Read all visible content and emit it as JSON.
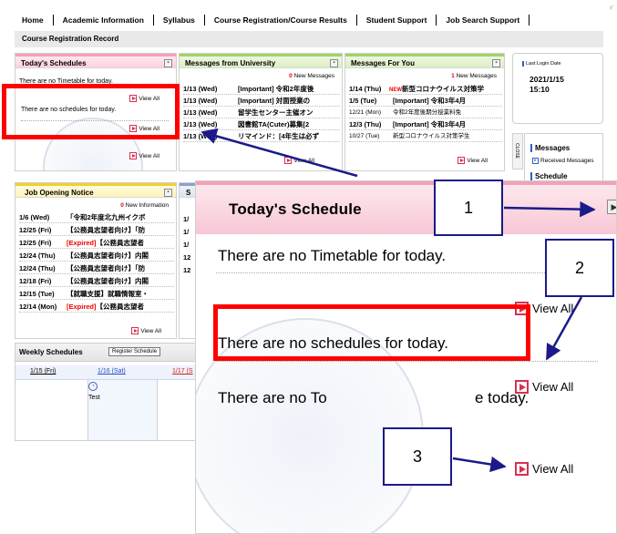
{
  "nav": {
    "items": [
      "Home",
      "Academic Information",
      "Syllabus",
      "Course Registration/Course Results",
      "Student Support",
      "Job Search Support"
    ],
    "sub": "Course Registration Record",
    "corner": "ｷﾞ"
  },
  "todays": {
    "title": "Today's Schedules",
    "timetable_msg": "There are no Timetable for today.",
    "schedule_msg": "There are no schedules for today.",
    "view_all": "View All"
  },
  "university": {
    "title": "Messages from University",
    "count": "0",
    "count_label": "New Messages",
    "rows": [
      {
        "date": "1/13 (Wed)",
        "text": "[Important] 令和2年度後"
      },
      {
        "date": "1/13 (Wed)",
        "text": "[Important] 対面授業の"
      },
      {
        "date": "1/13 (Wed)",
        "text": "留学生センター主催オン"
      },
      {
        "date": "1/13 (Wed)",
        "text": "図書館TA(Cuter)募集[2"
      },
      {
        "date": "1/13 (Wed)",
        "text": "リマインド：[4年生は必ず"
      }
    ],
    "view_all": "View All"
  },
  "foryou": {
    "title": "Messages For You",
    "count": "1",
    "count_label": "New Messages",
    "new_badge": "NEW",
    "rows": [
      {
        "date": "1/14 (Thu)",
        "text": "新型コロナウイルス対策学"
      },
      {
        "date": "1/5 (Tue)",
        "text": "[Important] 令和3年4月"
      },
      {
        "date": "12/21 (Mon)",
        "text": "令和2年度後期分授業料免"
      },
      {
        "date": "12/3 (Thu)",
        "text": "[Important] 令和3年4月"
      },
      {
        "date": "10/27 (Tue)",
        "text": "新型コロナウイルス対策学生"
      }
    ],
    "view_all": "View All"
  },
  "side": {
    "last_login_label": "Last Login Date",
    "date": "2021/1/15",
    "time": "15:10",
    "close": "CLOSE",
    "messages": "Messages",
    "received": "Received Messages",
    "schedule": "Schedule"
  },
  "jobs": {
    "title": "Job Opening Notice",
    "count": "0",
    "count_label": "New Information",
    "rows": [
      {
        "date": "1/6 (Wed)",
        "tag": "",
        "text": "「令和2年度北九州イクボ"
      },
      {
        "date": "12/25 (Fri)",
        "tag": "",
        "text": "【公務員志望者向け】「防"
      },
      {
        "date": "12/25 (Fri)",
        "tag": "[Expired]",
        "text": "【公務員志望者"
      },
      {
        "date": "12/24 (Thu)",
        "tag": "",
        "text": "【公務員志望者向け】内閣"
      },
      {
        "date": "12/24 (Thu)",
        "tag": "",
        "text": "【公務員志望者向け】「防"
      },
      {
        "date": "12/18 (Fri)",
        "tag": "",
        "text": "【公務員志望者向け】内閣"
      },
      {
        "date": "12/15 (Tue)",
        "tag": "",
        "text": "【就職支援】就職情報室・"
      },
      {
        "date": "12/14 (Mon)",
        "tag": "[Expired]",
        "text": "【公務員志望者"
      }
    ],
    "view_all": "View All"
  },
  "sliver": {
    "head": "S",
    "items": [
      "1/",
      "1/",
      "1/",
      "12",
      "12"
    ]
  },
  "weekly": {
    "title": "Weekly Schedules",
    "register": "Register Schedule",
    "days": [
      "1/15 (Fri)",
      "1/16 (Sat)",
      "1/17 (S"
    ],
    "event": "Test"
  },
  "zoom": {
    "title": "Today's Schedule",
    "timetable_msg": "There are no Timetable for today.",
    "schedule_msg": "There are no schedules for today.",
    "third_msg_left": "There are no To",
    "third_msg_right": "e today.",
    "view_all": "View All"
  },
  "callouts": [
    "1",
    "2",
    "3"
  ],
  "colors": {
    "annotation_red": "#ff0000",
    "callout_border": "#1a1a8a",
    "accent_pink": "#f4a0b8",
    "accent_green": "#9fd36a",
    "accent_yellow": "#f0d030",
    "expired_red": "#e00000"
  }
}
